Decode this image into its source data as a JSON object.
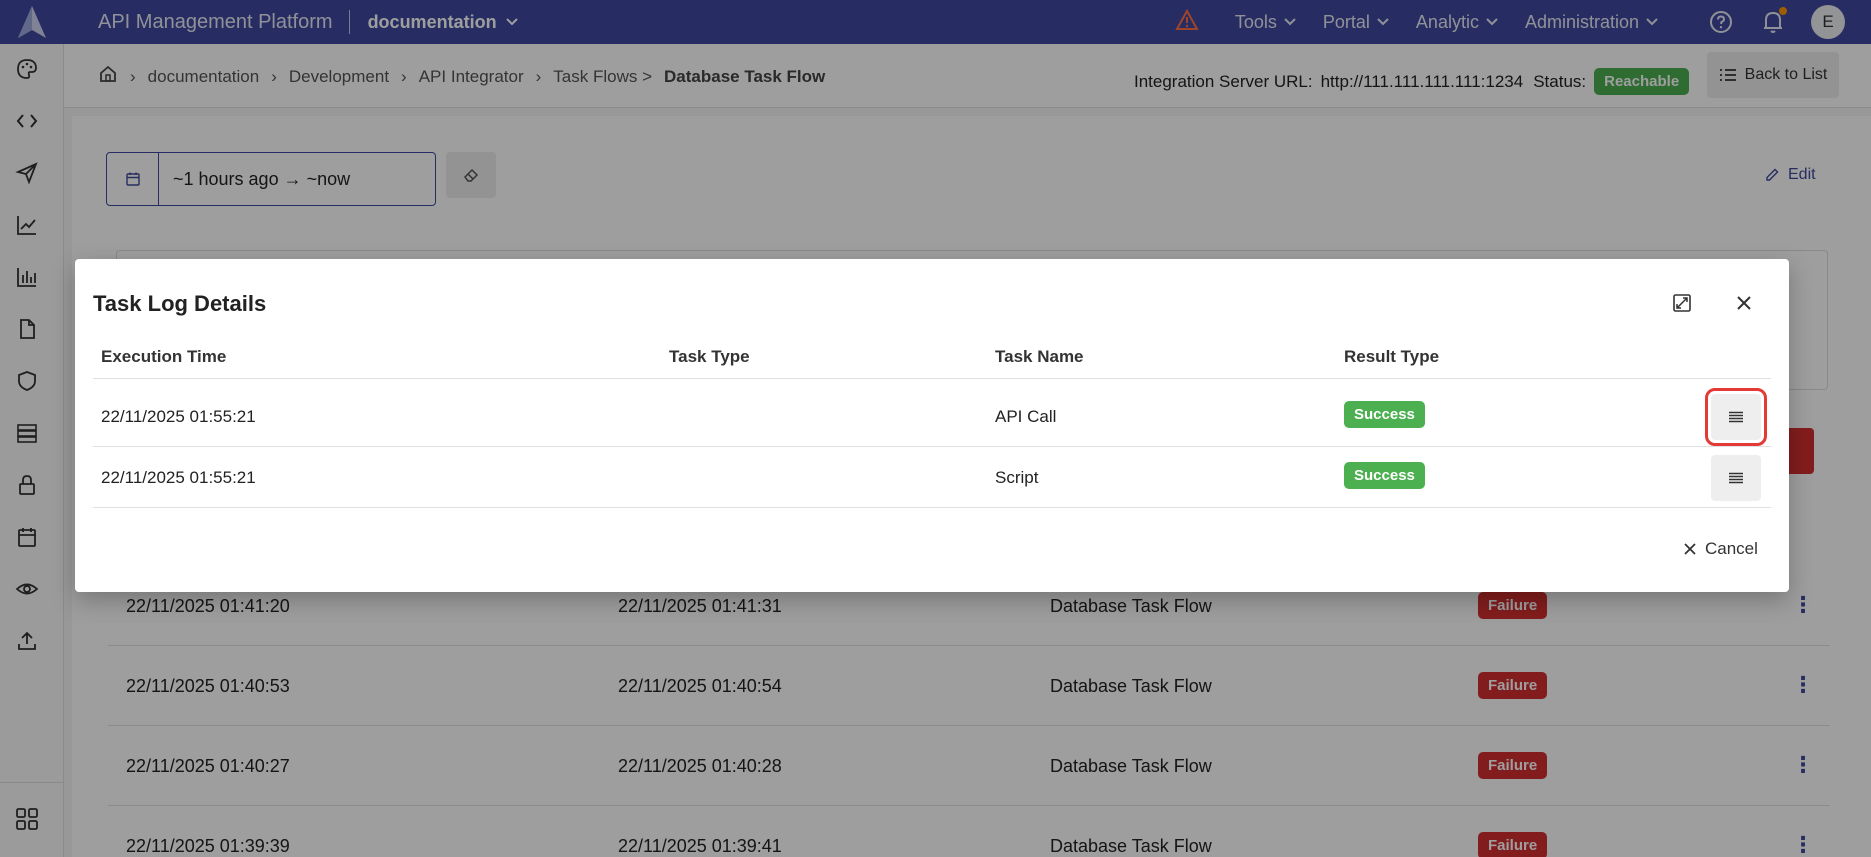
{
  "app": {
    "title": "API Management Platform",
    "workspace": "documentation"
  },
  "nav": {
    "items": [
      "Tools",
      "Portal",
      "Analytic",
      "Administration"
    ],
    "avatar_initial": "E"
  },
  "breadcrumb": {
    "items": [
      "documentation",
      "Development",
      "API Integrator",
      "Task Flows >"
    ],
    "current": "Database Task Flow"
  },
  "server": {
    "url_label": "Integration Server URL:",
    "url_value": "http://111.111.111.111:1234",
    "status_label": "Status:",
    "status_value": "Reachable"
  },
  "back_button": "Back to List",
  "filter": {
    "date_range": "~1 hours ago → ~now"
  },
  "edit_label": "Edit",
  "background_rows": [
    {
      "start": "22/11/2025 01:41:20",
      "end": "22/11/2025 01:41:31",
      "flow": "Database Task Flow",
      "status": "Failure"
    },
    {
      "start": "22/11/2025 01:40:53",
      "end": "22/11/2025 01:40:54",
      "flow": "Database Task Flow",
      "status": "Failure"
    },
    {
      "start": "22/11/2025 01:40:27",
      "end": "22/11/2025 01:40:28",
      "flow": "Database Task Flow",
      "status": "Failure"
    },
    {
      "start": "22/11/2025 01:39:39",
      "end": "22/11/2025 01:39:41",
      "flow": "Database Task Flow",
      "status": "Failure"
    }
  ],
  "modal": {
    "title": "Task Log Details",
    "columns": [
      "Execution Time",
      "Task Type",
      "Task Name",
      "Result Type"
    ],
    "rows": [
      {
        "time": "22/11/2025 01:55:21",
        "type": "",
        "name": "API Call",
        "result": "Success"
      },
      {
        "time": "22/11/2025 01:55:21",
        "type": "",
        "name": "Script",
        "result": "Success"
      }
    ],
    "cancel_label": "Cancel"
  },
  "colors": {
    "nav_bg": "#3f4a9e",
    "success": "#4caf50",
    "failure": "#d32f2f",
    "highlight": "#e53935"
  }
}
